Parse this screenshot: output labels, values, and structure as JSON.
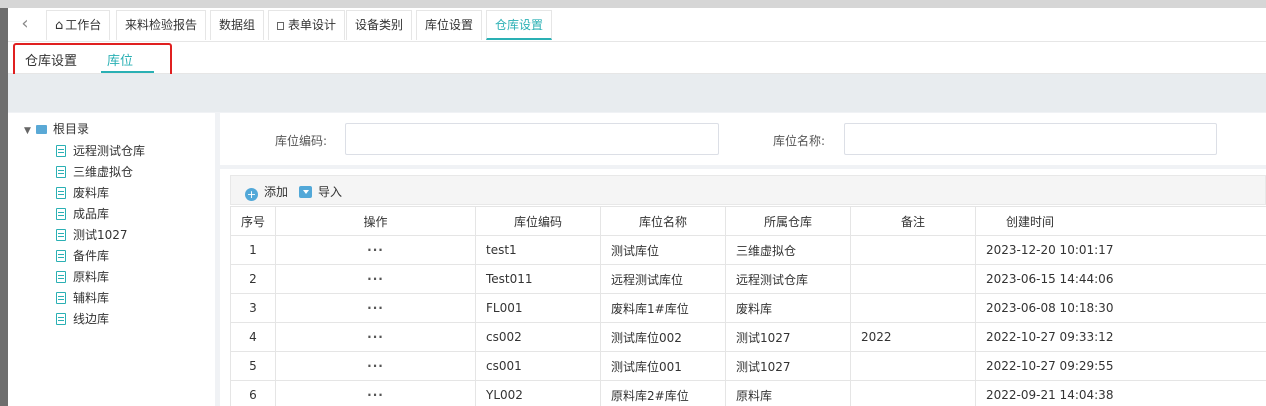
{
  "tabs": [
    {
      "label": "工作台",
      "icon": "home-icon"
    },
    {
      "label": "来料检验报告"
    },
    {
      "label": "数据组"
    },
    {
      "label": "表单设计"
    },
    {
      "label": "设备类别"
    },
    {
      "label": "库位设置"
    },
    {
      "label": "仓库设置",
      "active": true
    }
  ],
  "subtabs": {
    "warehouse": "仓库设置",
    "location": "库位"
  },
  "tree": {
    "root": "根目录",
    "items": [
      "远程测试仓库",
      "三维虚拟仓",
      "废料库",
      "成品库",
      "测试1027",
      "备件库",
      "原料库",
      "辅料库",
      "线边库"
    ]
  },
  "search": {
    "code_label": "库位编码:",
    "name_label": "库位名称:"
  },
  "toolbar": {
    "add": "添加",
    "import": "导入"
  },
  "table": {
    "headers": [
      "序号",
      "操作",
      "库位编码",
      "库位名称",
      "所属仓库",
      "备注",
      "创建时间"
    ],
    "rows": [
      [
        "1",
        "···",
        "test1",
        "测试库位",
        "三维虚拟仓",
        "",
        "2023-12-20 10:01:17"
      ],
      [
        "2",
        "···",
        "Test011",
        "远程测试库位",
        "远程测试仓库",
        "",
        "2023-06-15 14:44:06"
      ],
      [
        "3",
        "···",
        "FL001",
        "废料库1#库位",
        "废料库",
        "",
        "2023-06-08 10:18:30"
      ],
      [
        "4",
        "···",
        "cs002",
        "测试库位002",
        "测试1027",
        "2022",
        "2022-10-27 09:33:12"
      ],
      [
        "5",
        "···",
        "cs001",
        "测试库位001",
        "测试1027",
        "",
        "2022-10-27 09:29:55"
      ],
      [
        "6",
        "···",
        "YL002",
        "原料库2#库位",
        "原料库",
        "",
        "2022-09-21 14:04:38"
      ]
    ]
  },
  "colors": {
    "accent": "#2ab0b4",
    "highlight": "#e02020",
    "icon_blue": "#52a8d8"
  }
}
